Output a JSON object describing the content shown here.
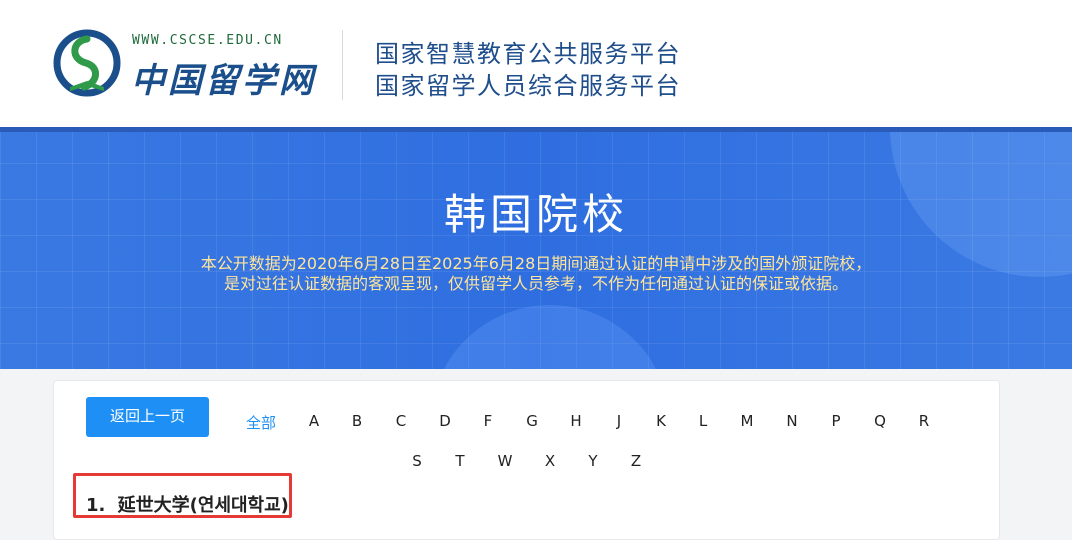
{
  "header": {
    "logo_url_text": "WWW.CSCSE.EDU.CN",
    "logo_name": "中国留学网",
    "platform_line_1": "国家智慧教育公共服务平台",
    "platform_line_2": "国家留学人员综合服务平台",
    "colors": {
      "logo_green": "#1f6a3a",
      "logo_blue": "#1a4f8b",
      "platform_text": "#1f4e8c"
    }
  },
  "hero": {
    "title": "韩国院校",
    "description_line_1": "本公开数据为2020年6月28日至2025年6月28日期间通过认证的申请中涉及的国外颁证院校，",
    "description_line_2": "是对过往认证数据的客观呈现，仅供留学人员参考，不作为任何通过认证的保证或依据。",
    "colors": {
      "background": "#2f6ee0",
      "title": "#ffffff",
      "description": "#ffe59a"
    }
  },
  "filter": {
    "back_label": "返回上一页",
    "all_label": "全部",
    "letters_row_1": [
      "A",
      "B",
      "C",
      "D",
      "F",
      "G",
      "H",
      "J",
      "K",
      "L",
      "M",
      "N",
      "P",
      "Q",
      "R"
    ],
    "letters_row_2": [
      "S",
      "T",
      "W",
      "X",
      "Y",
      "Z"
    ],
    "colors": {
      "accent": "#1e90f5"
    }
  },
  "results": {
    "items": [
      {
        "index": "1.",
        "name": "延世大学(연세대학교)"
      }
    ],
    "highlight_color": "#e53935"
  }
}
